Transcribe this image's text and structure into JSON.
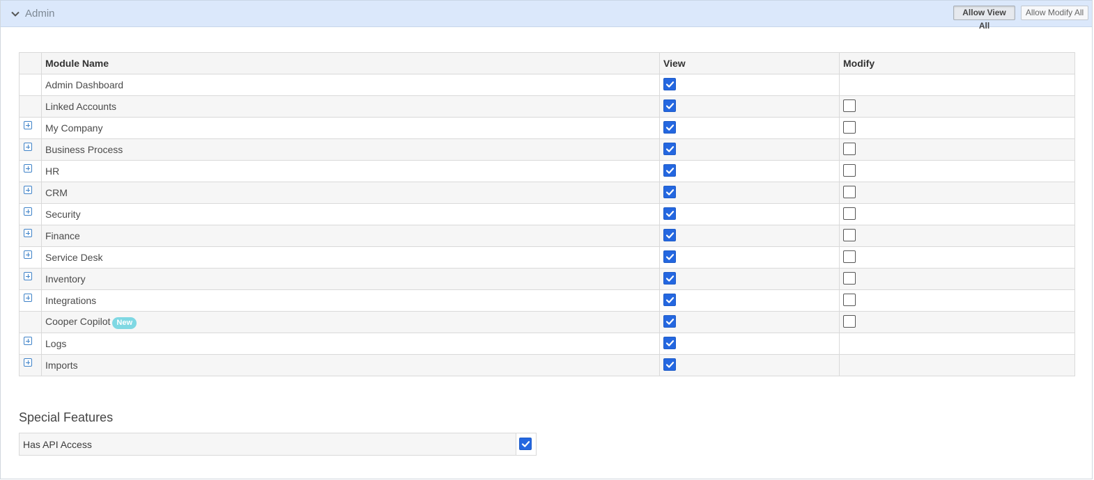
{
  "section": {
    "title": "Admin",
    "allow_view_all_label": "Allow View All",
    "allow_modify_all_label": "Allow Modify All"
  },
  "table": {
    "headers": {
      "module": "Module Name",
      "view": "View",
      "modify": "Modify"
    },
    "rows": [
      {
        "name": "Admin Dashboard",
        "expandable": false,
        "view": true,
        "modify": null
      },
      {
        "name": "Linked Accounts",
        "expandable": false,
        "view": true,
        "modify": false
      },
      {
        "name": "My Company",
        "expandable": true,
        "view": true,
        "modify": false
      },
      {
        "name": "Business Process",
        "expandable": true,
        "view": true,
        "modify": false
      },
      {
        "name": "HR",
        "expandable": true,
        "view": true,
        "modify": false
      },
      {
        "name": "CRM",
        "expandable": true,
        "view": true,
        "modify": false
      },
      {
        "name": "Security",
        "expandable": true,
        "view": true,
        "modify": false
      },
      {
        "name": "Finance",
        "expandable": true,
        "view": true,
        "modify": false
      },
      {
        "name": "Service Desk",
        "expandable": true,
        "view": true,
        "modify": false
      },
      {
        "name": "Inventory",
        "expandable": true,
        "view": true,
        "modify": false
      },
      {
        "name": "Integrations",
        "expandable": true,
        "view": true,
        "modify": false
      },
      {
        "name": "Cooper Copilot",
        "badge": "New",
        "expandable": false,
        "view": true,
        "modify": false
      },
      {
        "name": "Logs",
        "expandable": true,
        "view": true,
        "modify": null
      },
      {
        "name": "Imports",
        "expandable": true,
        "view": true,
        "modify": null
      }
    ]
  },
  "special_features": {
    "title": "Special Features",
    "items": [
      {
        "label": "Has API Access",
        "checked": true
      }
    ]
  },
  "icons": {
    "collapse": "chevron-down-icon",
    "expand": "plus-square-icon",
    "check": "checkmark-icon"
  },
  "colors": {
    "header_bg": "#dbe8fb",
    "checkbox_checked": "#2467e0",
    "expand_icon": "#3e82c8",
    "badge_bg": "#7fd8e3"
  }
}
